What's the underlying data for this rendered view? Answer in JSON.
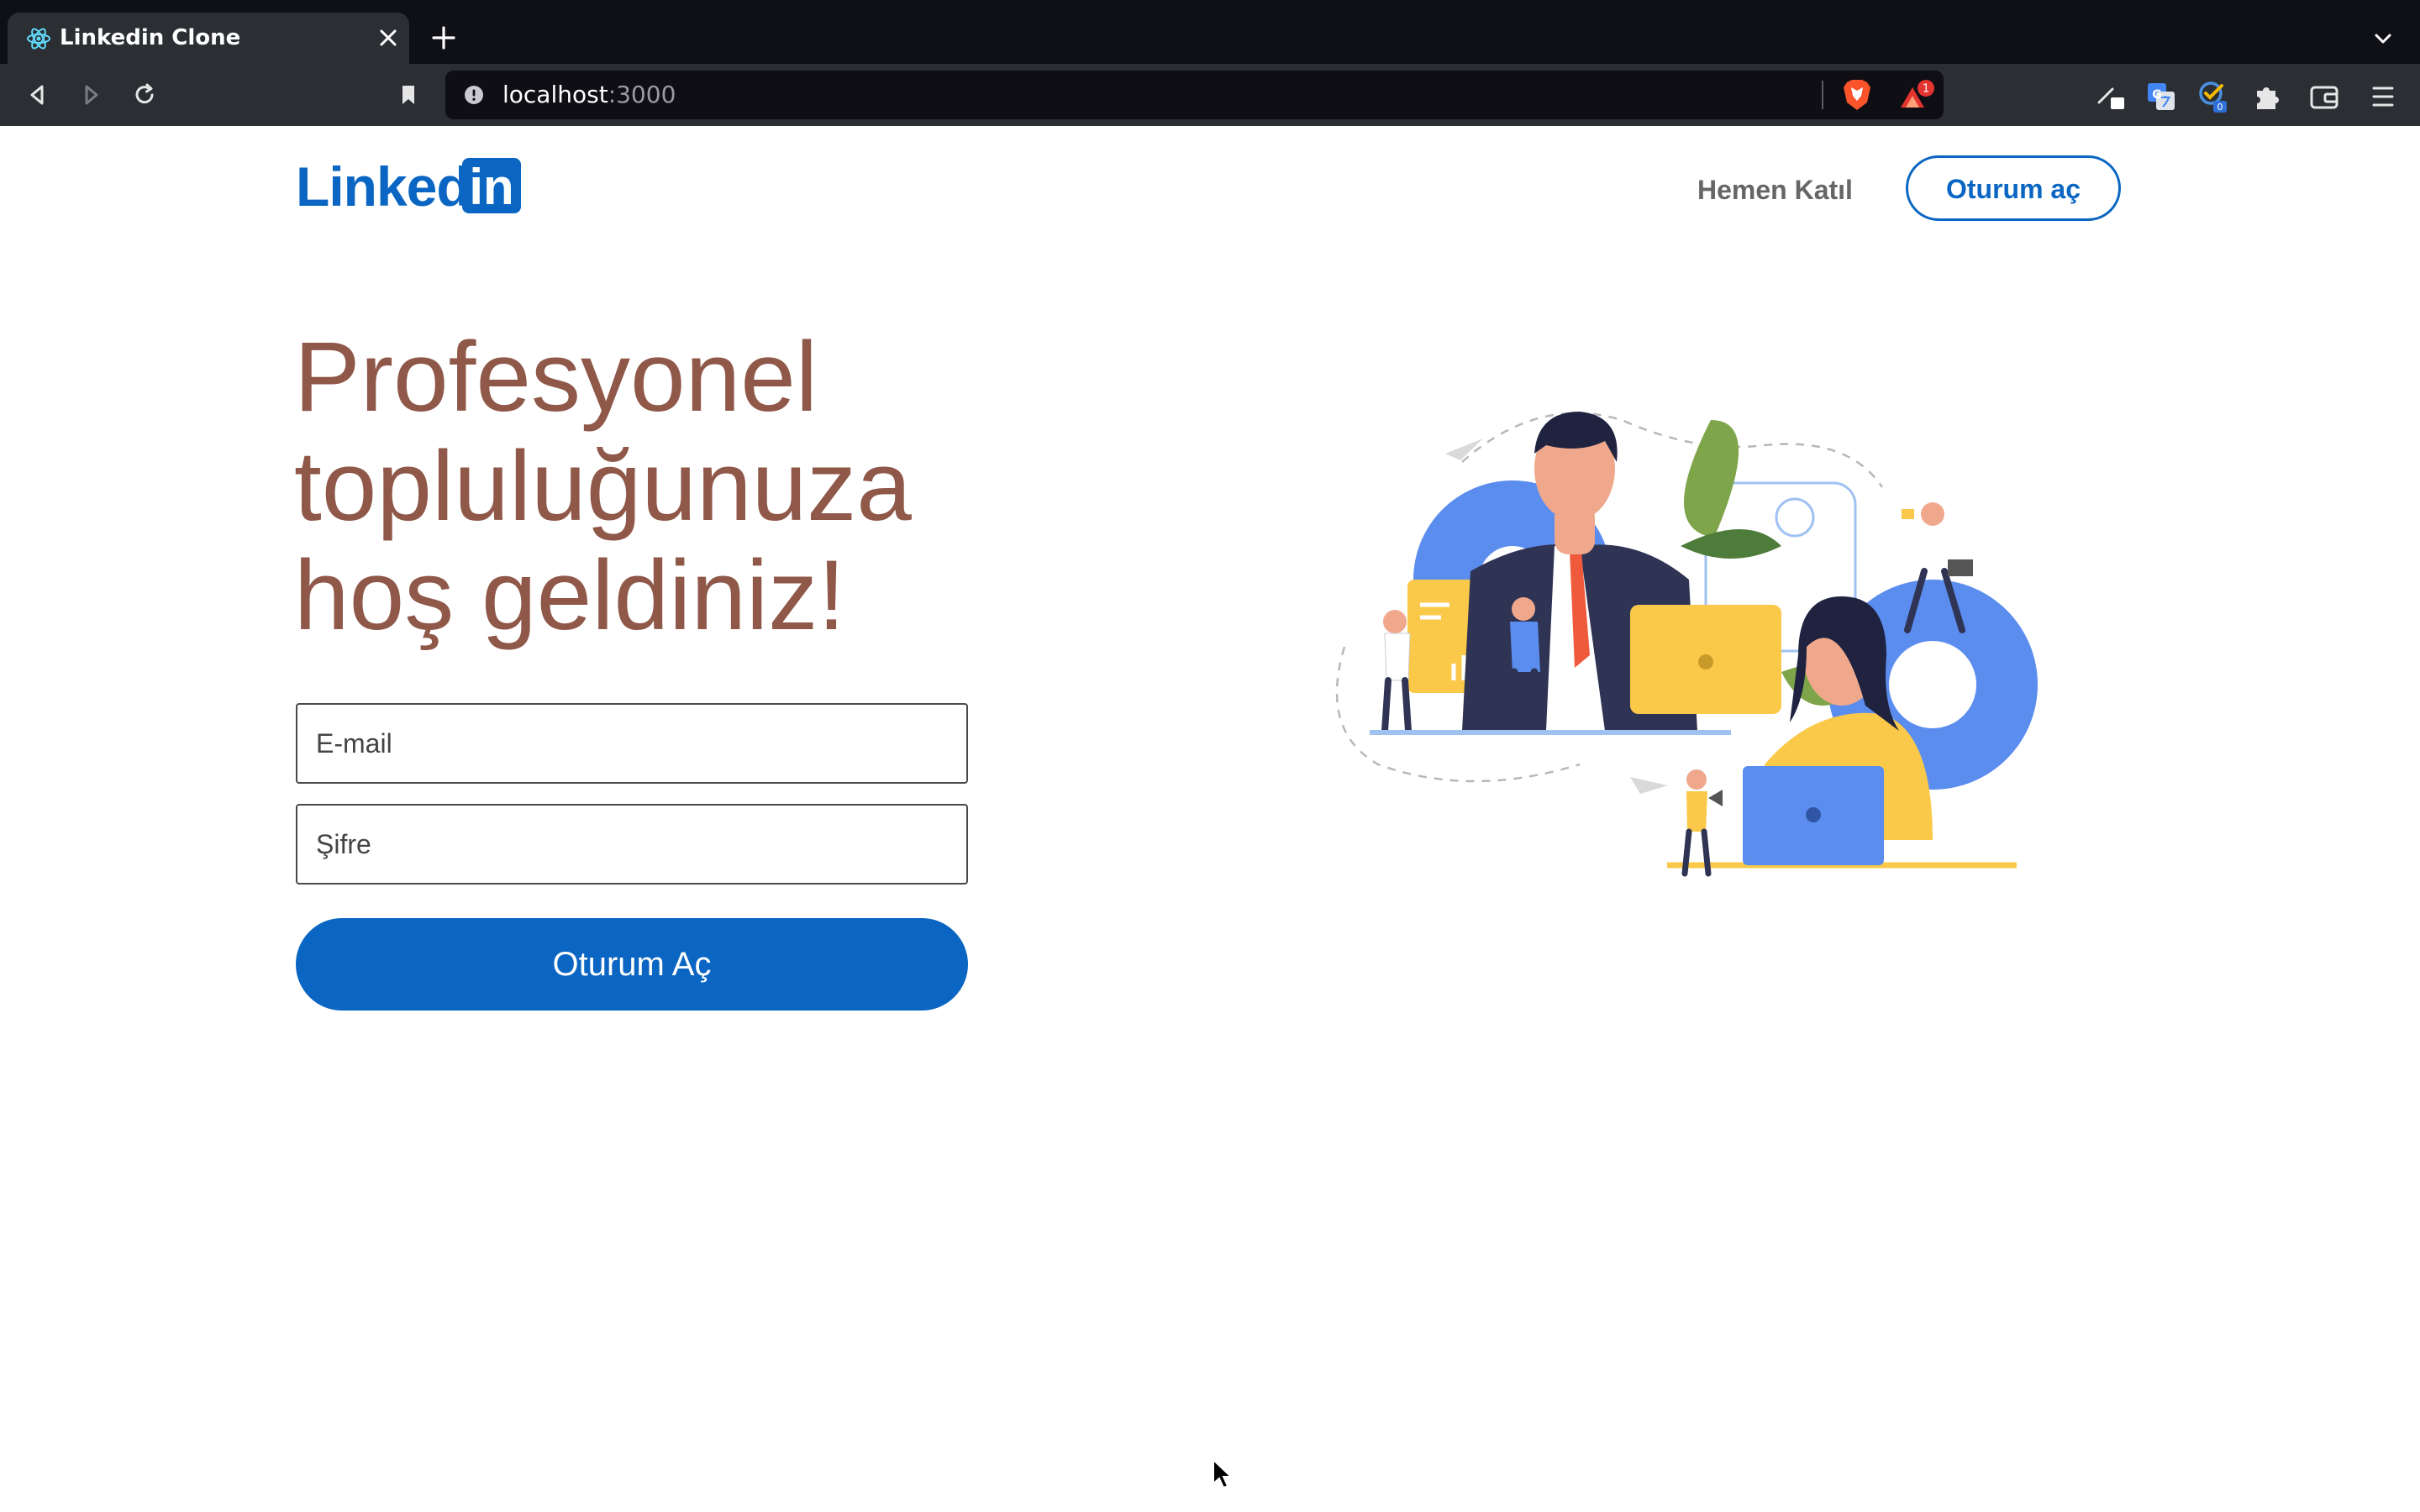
{
  "browser": {
    "tab": {
      "title": "Linkedin Clone",
      "favicon": "react-atom-icon"
    },
    "address": {
      "host": "localhost",
      "port": ":3000"
    },
    "rewards_badge": "1",
    "extension_badge": "0",
    "colors": {
      "tabbar": "#0f0f16",
      "toolbar": "#2b2e33",
      "urlbar": "#0e0e14"
    }
  },
  "header": {
    "logo_word": "Linked",
    "logo_box": "in",
    "join_label": "Hemen Katıl",
    "signin_label": "Oturum aç"
  },
  "hero": {
    "headline_lines": [
      "Profesyonel",
      "topluluğunuza",
      "hoş geldiniz!"
    ]
  },
  "form": {
    "email_placeholder": "E-mail",
    "password_placeholder": "Şifre",
    "submit_label": "Oturum Aç"
  },
  "colors": {
    "brand": "#0a66c2",
    "headline": "#8f5849",
    "muted_link": "#666666",
    "illustration_blue": "#5b8def",
    "illustration_yellow": "#fbc94a"
  }
}
